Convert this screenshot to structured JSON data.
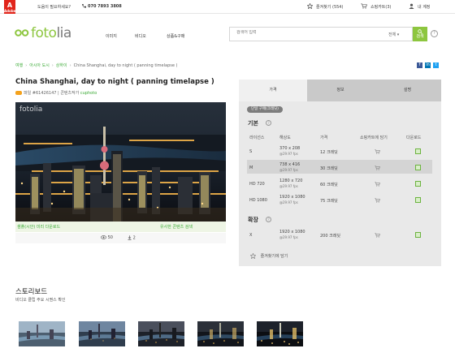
{
  "topbar": {
    "adobe_logo": "Adobe",
    "help": "도움이 필요하세요?",
    "phone": "070 7893 3808",
    "favorites": "즐겨찾기 (554)",
    "cart": "쇼핑카트(3)",
    "account": "내 계정"
  },
  "header": {
    "logo_brand": "foto",
    "logo_suffix": "lia",
    "nav": [
      "이미지",
      "비디오",
      "상품&구매"
    ],
    "search_placeholder": "검색어 입력",
    "search_scope": "전체",
    "search_button": "검색",
    "help": "?"
  },
  "breadcrumb": {
    "items": [
      "여행",
      "아시아 도시",
      "상하이"
    ],
    "current": "China Shanghai, day to night ( panning timelapse )"
  },
  "social": [
    "f",
    "in",
    "t"
  ],
  "asset": {
    "title": "China Shanghai, day to night ( panning timelapse )",
    "file_label": "파일",
    "file_id": "#61426147",
    "contributor_label": "콘텐츠작가",
    "contributor": "cuphoto",
    "watermark": "fotolia",
    "download_sample": "샘플(시안) 미리 다운로드",
    "similar": "유사한 콘텐츠 검색",
    "views": "50",
    "downloads": "2"
  },
  "pricing": {
    "tabs": [
      "가격",
      "정보",
      "설명"
    ],
    "badge": "단일 구매(크레딧)",
    "basic_title": "기본",
    "extended_title": "확장",
    "columns": [
      "라이선스",
      "해상도",
      "가격",
      "쇼핑카트에 담기",
      "다운로드"
    ],
    "rows": [
      {
        "license": "S",
        "res": "370 x 208",
        "fps": "@29.97 fps",
        "price": "12 크레딧"
      },
      {
        "license": "M",
        "res": "738 x 416",
        "fps": "@29.97 fps",
        "price": "30 크레딧"
      },
      {
        "license": "HD 720",
        "res": "1280 x 720",
        "fps": "@29.97 fps",
        "price": "60 크레딧"
      },
      {
        "license": "HD 1080",
        "res": "1920 x 1080",
        "fps": "@29.97 fps",
        "price": "75 크레딧"
      }
    ],
    "extended_row": {
      "license": "X",
      "res": "1920 x 1080",
      "fps": "@29.97 fps",
      "price": "200 크레딧"
    },
    "favorite": "즐겨찾기에 담기"
  },
  "storyboard": {
    "title": "스토리보드",
    "subtitle": "비디오 클립 주요 시퀀스 확인"
  },
  "colors": {
    "brand_green": "#8dc63f",
    "link_green": "#3aaa35",
    "adobe_red": "#e1251b"
  }
}
